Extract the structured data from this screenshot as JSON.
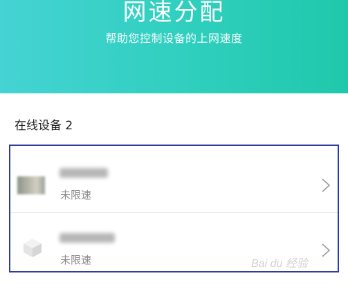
{
  "header": {
    "title": "网速分配",
    "subtitle": "帮助您控制设备的上网速度"
  },
  "online_section": {
    "label": "在线设备 2"
  },
  "devices": [
    {
      "status": "未限速",
      "icon": "device-thumbnail"
    },
    {
      "status": "未限速",
      "icon": "cube-icon"
    }
  ],
  "watermark": "Bai du 经验",
  "colors": {
    "header_start": "#45d3d3",
    "header_end": "#20c8ab",
    "highlight_border": "#2f3aa3",
    "status_text": "#8a8a8a"
  }
}
